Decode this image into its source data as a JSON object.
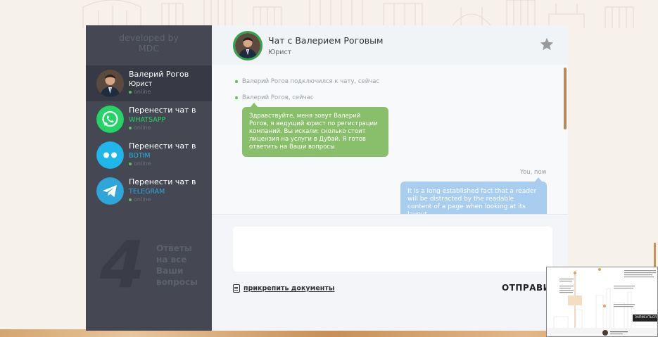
{
  "sidebar": {
    "developed_by": "developed by",
    "developer": "MDC",
    "contacts": [
      {
        "name": "Валерий Рогов",
        "sub": "Юрист",
        "status": "online",
        "avatar": "lawyer-avatar"
      },
      {
        "name": "Перенести чат в",
        "sub": "WHATSAPP",
        "status": "online",
        "avatar": "whatsapp-icon",
        "color": "#25d366"
      },
      {
        "name": "Перенести чат в",
        "sub": "BOTIM",
        "status": "online",
        "avatar": "botim-icon",
        "color": "#1fb6ea"
      },
      {
        "name": "Перенести чат в",
        "sub": "TELEGRAM",
        "status": "online",
        "avatar": "telegram-icon",
        "color": "#2ea6da"
      }
    ],
    "promo": {
      "number": "4",
      "lines": [
        "Ответы",
        "на все",
        "Ваши",
        "вопросы"
      ]
    }
  },
  "chat": {
    "title": "Чат с Валерием Роговым",
    "subtitle": "Юрист",
    "messages": {
      "system1": "Валерий Рогов подключился к чату, сейчас",
      "system2": "Валерий Рогов, сейчас",
      "incoming": "Здравствуйте, меня зовут Валерий Рогов, я ведущий юрист по регистрации компаний. Вы искали: сколько стоит лицензия на услуги в Дубай. Я готов ответить на Ваши вопросы",
      "you_label": "You, now",
      "outgoing": "It is a long established fact that a reader will be distracted by the readable content of a page when looking at its layout."
    },
    "input_placeholder": "",
    "attach_label": "прикрепить документы",
    "send_label": "ОТПРАВИТ"
  },
  "thumbnail": {
    "cta": "ЗАПИСАТЬСЯ НА"
  },
  "colors": {
    "sidebar": "#454853",
    "accent_green": "#89be6a",
    "accent_blue": "#a8cdee",
    "scroll": "#b98a57"
  }
}
